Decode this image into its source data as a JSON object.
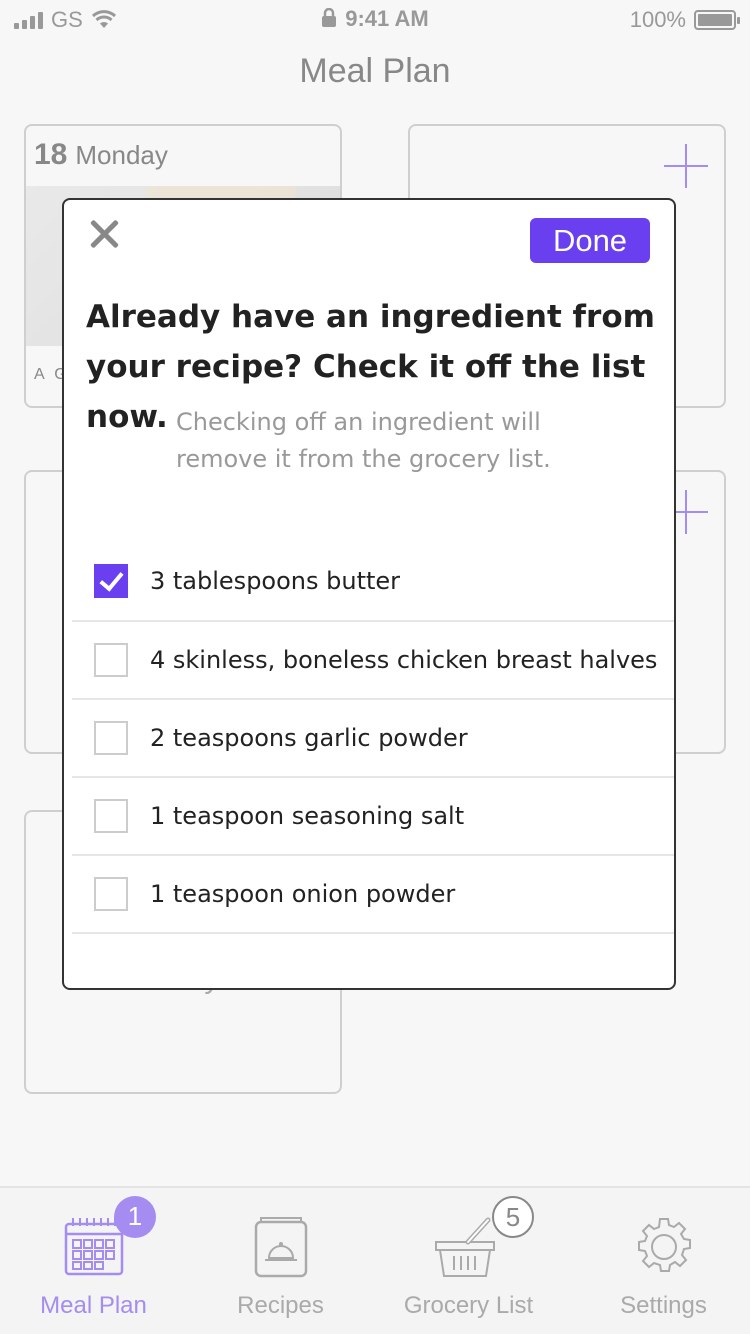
{
  "status_bar": {
    "carrier": "GS",
    "time": "9:41 AM",
    "battery": "100%"
  },
  "page_title": "Meal Plan",
  "days": [
    {
      "number": "18",
      "name": "Monday",
      "caption": "A G"
    },
    {
      "name": "Friday"
    }
  ],
  "modal": {
    "close_icon": "close-icon",
    "done_label": "Done",
    "heading": "Already have an ingredient from your recipe? Check it off the list now.",
    "subtext": "Checking off an ingredient will remove it from the grocery list.",
    "ingredients": [
      {
        "label": "3 tablespoons butter",
        "checked": true
      },
      {
        "label": "4 skinless, boneless chicken breast halves",
        "checked": false
      },
      {
        "label": "2 teaspoons garlic powder",
        "checked": false
      },
      {
        "label": "1 teaspoon seasoning salt",
        "checked": false
      },
      {
        "label": "1 teaspoon onion powder",
        "checked": false
      }
    ]
  },
  "tabs": [
    {
      "label": "Meal Plan",
      "icon": "calendar-icon",
      "badge": "1",
      "active": true
    },
    {
      "label": "Recipes",
      "icon": "recipe-box-icon",
      "active": false
    },
    {
      "label": "Grocery List",
      "icon": "basket-icon",
      "badge": "5",
      "active": false
    },
    {
      "label": "Settings",
      "icon": "gear-icon",
      "active": false
    }
  ],
  "colors": {
    "accent": "#6a3ff0",
    "accent_light": "#a58cf0",
    "background": "#f7f7f7",
    "muted_text": "#999999"
  }
}
